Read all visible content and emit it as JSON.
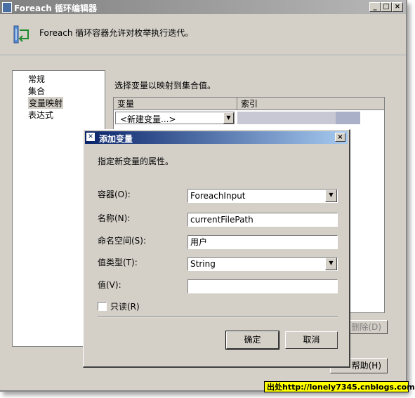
{
  "window": {
    "title": "Foreach 循环编辑器",
    "minimize_glyph": "_",
    "maximize_glyph": "□",
    "close_glyph": "×",
    "description": "Foreach 循环容器允许对枚举执行迭代。"
  },
  "nav": {
    "items": [
      "常规",
      "集合",
      "变量映射",
      "表达式"
    ],
    "selected": "变量映射"
  },
  "mapping": {
    "label": "选择变量以映射到集合值。",
    "columns": [
      "变量",
      "索引"
    ],
    "new_variable": "<新建变量...>",
    "delete_button": "删除(D)",
    "help_button": "帮助(H)"
  },
  "dialog": {
    "title": "添加变量",
    "close_glyph": "×",
    "description": "指定新变量的属性。",
    "container_label": "容器(O):",
    "container_value": "ForeachInput",
    "name_label": "名称(N):",
    "name_value": "currentFilePath",
    "namespace_label": "命名空间(S):",
    "namespace_value": "用户",
    "value_type_label": "值类型(T):",
    "value_type_value": "String",
    "value_label": "值(V):",
    "value_value": "",
    "readonly_label": "只读(R)",
    "readonly_checked": false,
    "ok_label": "确定",
    "cancel_label": "取消"
  },
  "watermark": "出处http://lonely7345.cnblogs.com"
}
